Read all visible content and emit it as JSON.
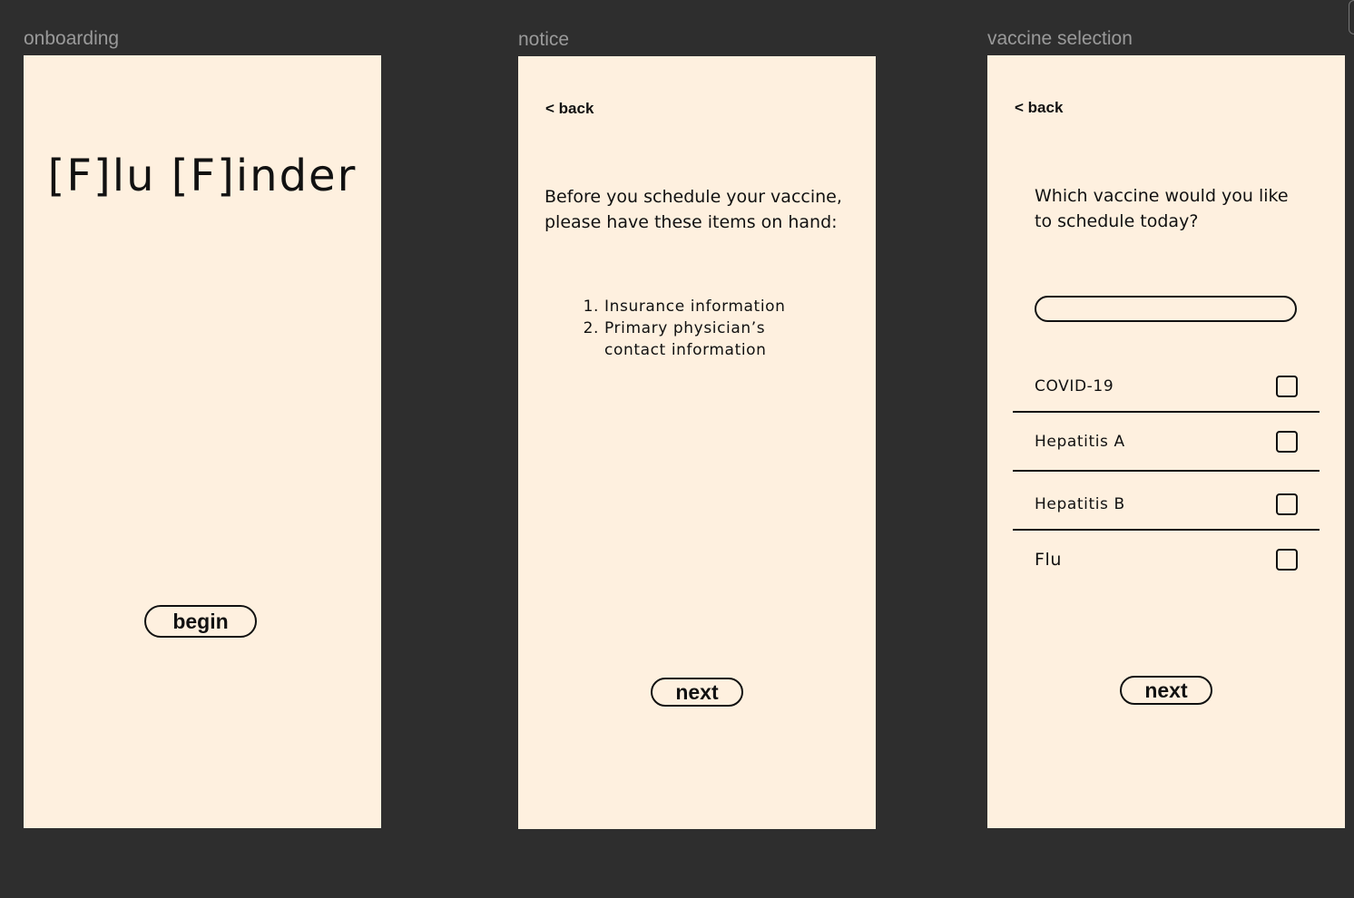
{
  "frames": {
    "onboarding": {
      "label": "onboarding",
      "title": "[F]lu [F]inder",
      "begin_label": "begin"
    },
    "notice": {
      "label": "notice",
      "back_label": "< back",
      "heading_line1": "Before you schedule your vaccine,",
      "heading_line2": "please have these items on hand:",
      "items": [
        {
          "num": "1.",
          "text": "Insurance information"
        },
        {
          "num": "2.",
          "text": "Primary physician’s"
        },
        {
          "num": "",
          "text": "contact information"
        }
      ],
      "next_label": "next"
    },
    "vaccine_selection": {
      "label": "vaccine selection",
      "back_label": "< back",
      "heading_line1": "Which vaccine would you like",
      "heading_line2": "to schedule today?",
      "search": {
        "value": "",
        "placeholder": ""
      },
      "options": [
        {
          "label": "COVID-19",
          "checked": false
        },
        {
          "label": "Hepatitis A",
          "checked": false
        },
        {
          "label": "Hepatitis B",
          "checked": false
        },
        {
          "label": "Flu",
          "checked": false
        }
      ],
      "next_label": "next"
    }
  },
  "colors": {
    "canvas": "#2e2e2e",
    "frame_bg": "#fef0df",
    "frame_label": "#9a9a9a",
    "ink": "#111111"
  }
}
